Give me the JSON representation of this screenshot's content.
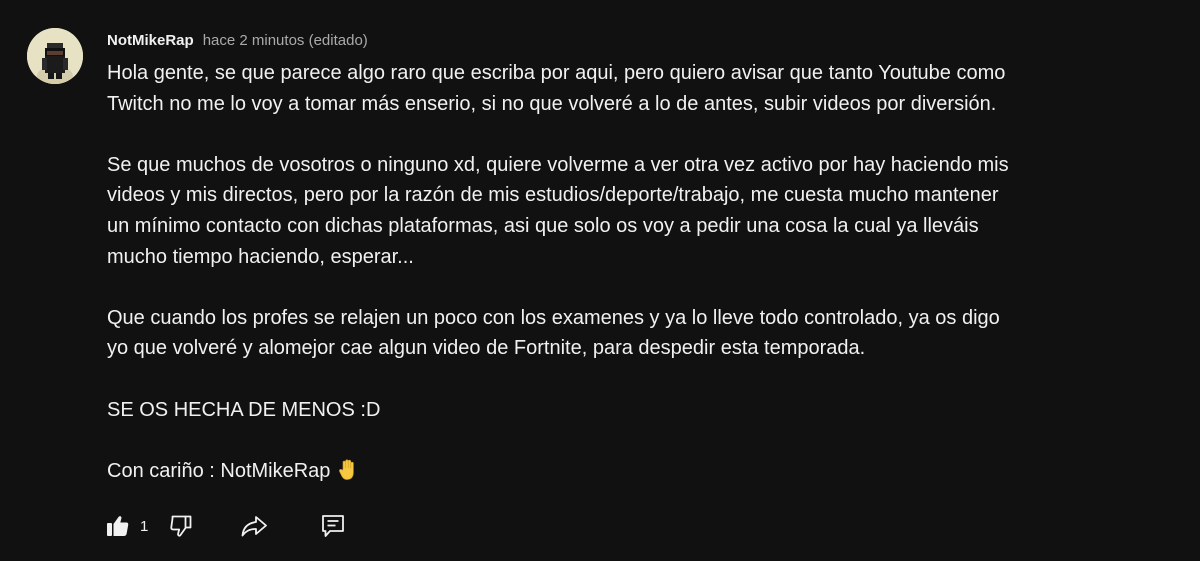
{
  "comment": {
    "author": "NotMikeRap",
    "timestamp": "hace 2 minutos (editado)",
    "paragraphs": [
      [
        "Hola gente, se que parece algo raro que escriba por aqui, pero quiero avisar que tanto Youtube como",
        "Twitch no me lo voy a tomar más enserio, si no que volveré a lo de antes, subir videos por diversión."
      ],
      [
        "Se que muchos de vosotros o ninguno xd, quiere volverme a ver otra vez activo por hay haciendo mis",
        "videos y mis directos, pero por la razón de mis estudios/deporte/trabajo, me cuesta mucho mantener",
        "un mínimo contacto con dichas plataformas, asi que solo os voy a pedir una cosa la cual ya lleváis",
        "mucho tiempo haciendo, esperar..."
      ],
      [
        "Que cuando los profes se relajen un poco con los examenes y ya lo lleve todo controlado, ya os digo",
        "yo que volveré y alomejor cae algun video de Fortnite, para despedir esta temporada."
      ],
      [
        "SE OS HECHA DE MENOS :D"
      ],
      [
        "Con cariño : NotMikeRap"
      ]
    ],
    "signature_emoji": "raised-hand-emoji",
    "like_count": "1"
  },
  "icons": {
    "like": "thumbs-up-icon",
    "dislike": "thumbs-down-icon",
    "share": "share-arrow-icon",
    "report": "comment-flag-icon"
  },
  "colors": {
    "background": "#111111",
    "text": "#f1f1f1",
    "muted": "#aaaaaa",
    "emoji": "#f7c742"
  }
}
